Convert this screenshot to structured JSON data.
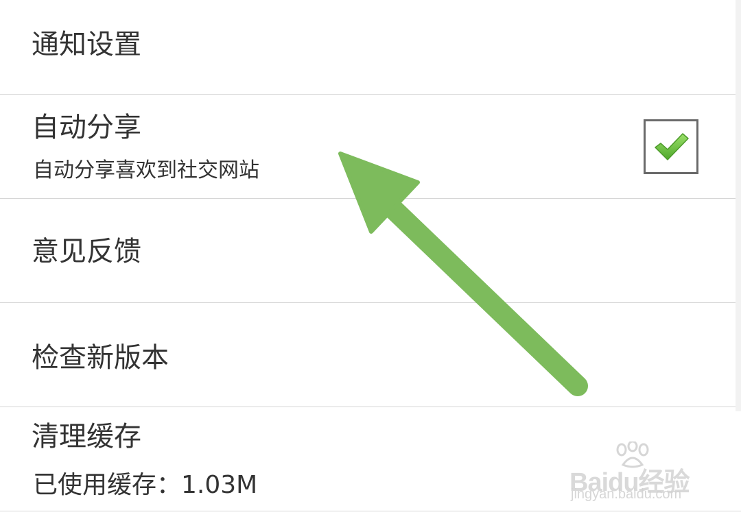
{
  "settings": {
    "items": [
      {
        "title": "通知设置"
      },
      {
        "title": "自动分享",
        "subtitle": "自动分享喜欢到社交网站",
        "checked": true
      },
      {
        "title": "意见反馈"
      },
      {
        "title": "检查新版本"
      },
      {
        "title": "清理缓存",
        "subtitle": "已使用缓存：1.03M"
      }
    ]
  },
  "annotation": {
    "arrow_color": "#7dbb5c",
    "arrow_icon": "green-arrow-icon"
  },
  "colors": {
    "divider": "#d6d6d6",
    "text": "#333333",
    "checkmark": "#6cc13f",
    "checkbox_border": "#6a6a6a"
  },
  "watermark": {
    "brand": "Baidu经验",
    "url": "jingyan.baidu.com"
  }
}
